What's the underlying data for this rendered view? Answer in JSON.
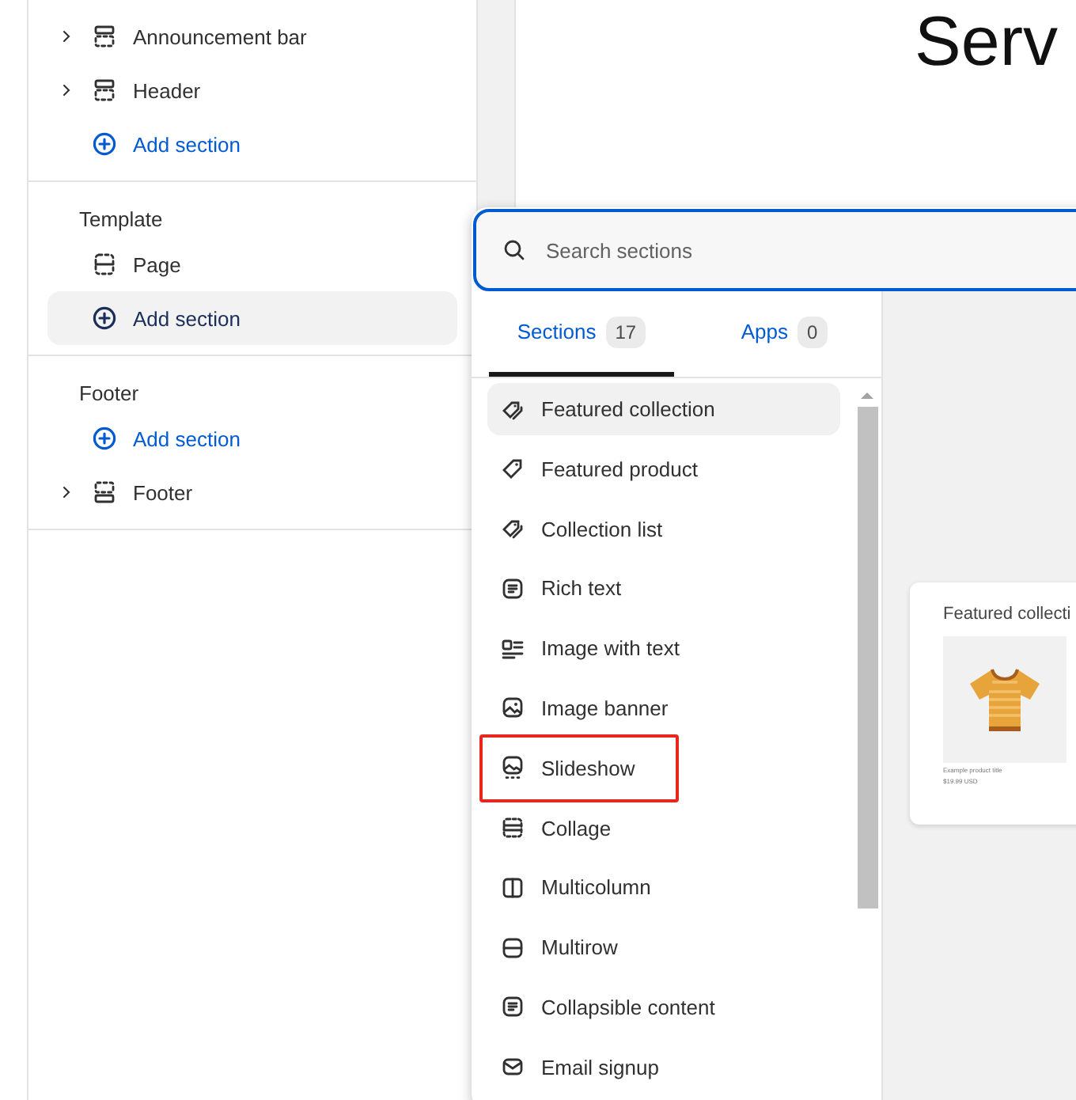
{
  "sidebar": {
    "groups": [
      {
        "items": [
          {
            "kind": "section",
            "label": "Announcement bar",
            "expanded": false,
            "highlighted": false
          },
          {
            "kind": "section",
            "label": "Header",
            "expanded": false,
            "highlighted": false
          },
          {
            "kind": "add",
            "label": "Add section",
            "highlighted": false
          }
        ]
      },
      {
        "title": "Template",
        "items": [
          {
            "kind": "template",
            "label": "Page",
            "highlighted": false
          },
          {
            "kind": "add",
            "label": "Add section",
            "highlighted": true
          }
        ]
      },
      {
        "title": "Footer",
        "items": [
          {
            "kind": "add",
            "label": "Add section",
            "highlighted": false
          },
          {
            "kind": "section",
            "label": "Footer",
            "expanded": false,
            "highlighted": false
          }
        ]
      }
    ]
  },
  "preview": {
    "heading": "Serv",
    "card": {
      "title": "Featured collecti",
      "product_title": "Example product title",
      "price": "$19.99 USD"
    }
  },
  "picker": {
    "search": {
      "placeholder": "Search sections"
    },
    "tabs": [
      {
        "label": "Sections",
        "count": "17",
        "selected": true
      },
      {
        "label": "Apps",
        "count": "0",
        "selected": false
      }
    ],
    "items": [
      {
        "label": "Featured collection",
        "highlighted": true,
        "annotated": false
      },
      {
        "label": "Featured product",
        "highlighted": false,
        "annotated": false
      },
      {
        "label": "Collection list",
        "highlighted": false,
        "annotated": false
      },
      {
        "label": "Rich text",
        "highlighted": false,
        "annotated": false
      },
      {
        "label": "Image with text",
        "highlighted": false,
        "annotated": false
      },
      {
        "label": "Image banner",
        "highlighted": false,
        "annotated": false
      },
      {
        "label": "Slideshow",
        "highlighted": false,
        "annotated": true
      },
      {
        "label": "Collage",
        "highlighted": false,
        "annotated": false
      },
      {
        "label": "Multicolumn",
        "highlighted": false,
        "annotated": false
      },
      {
        "label": "Multirow",
        "highlighted": false,
        "annotated": false
      },
      {
        "label": "Collapsible content",
        "highlighted": false,
        "annotated": false
      },
      {
        "label": "Email signup",
        "highlighted": false,
        "annotated": false
      }
    ]
  }
}
